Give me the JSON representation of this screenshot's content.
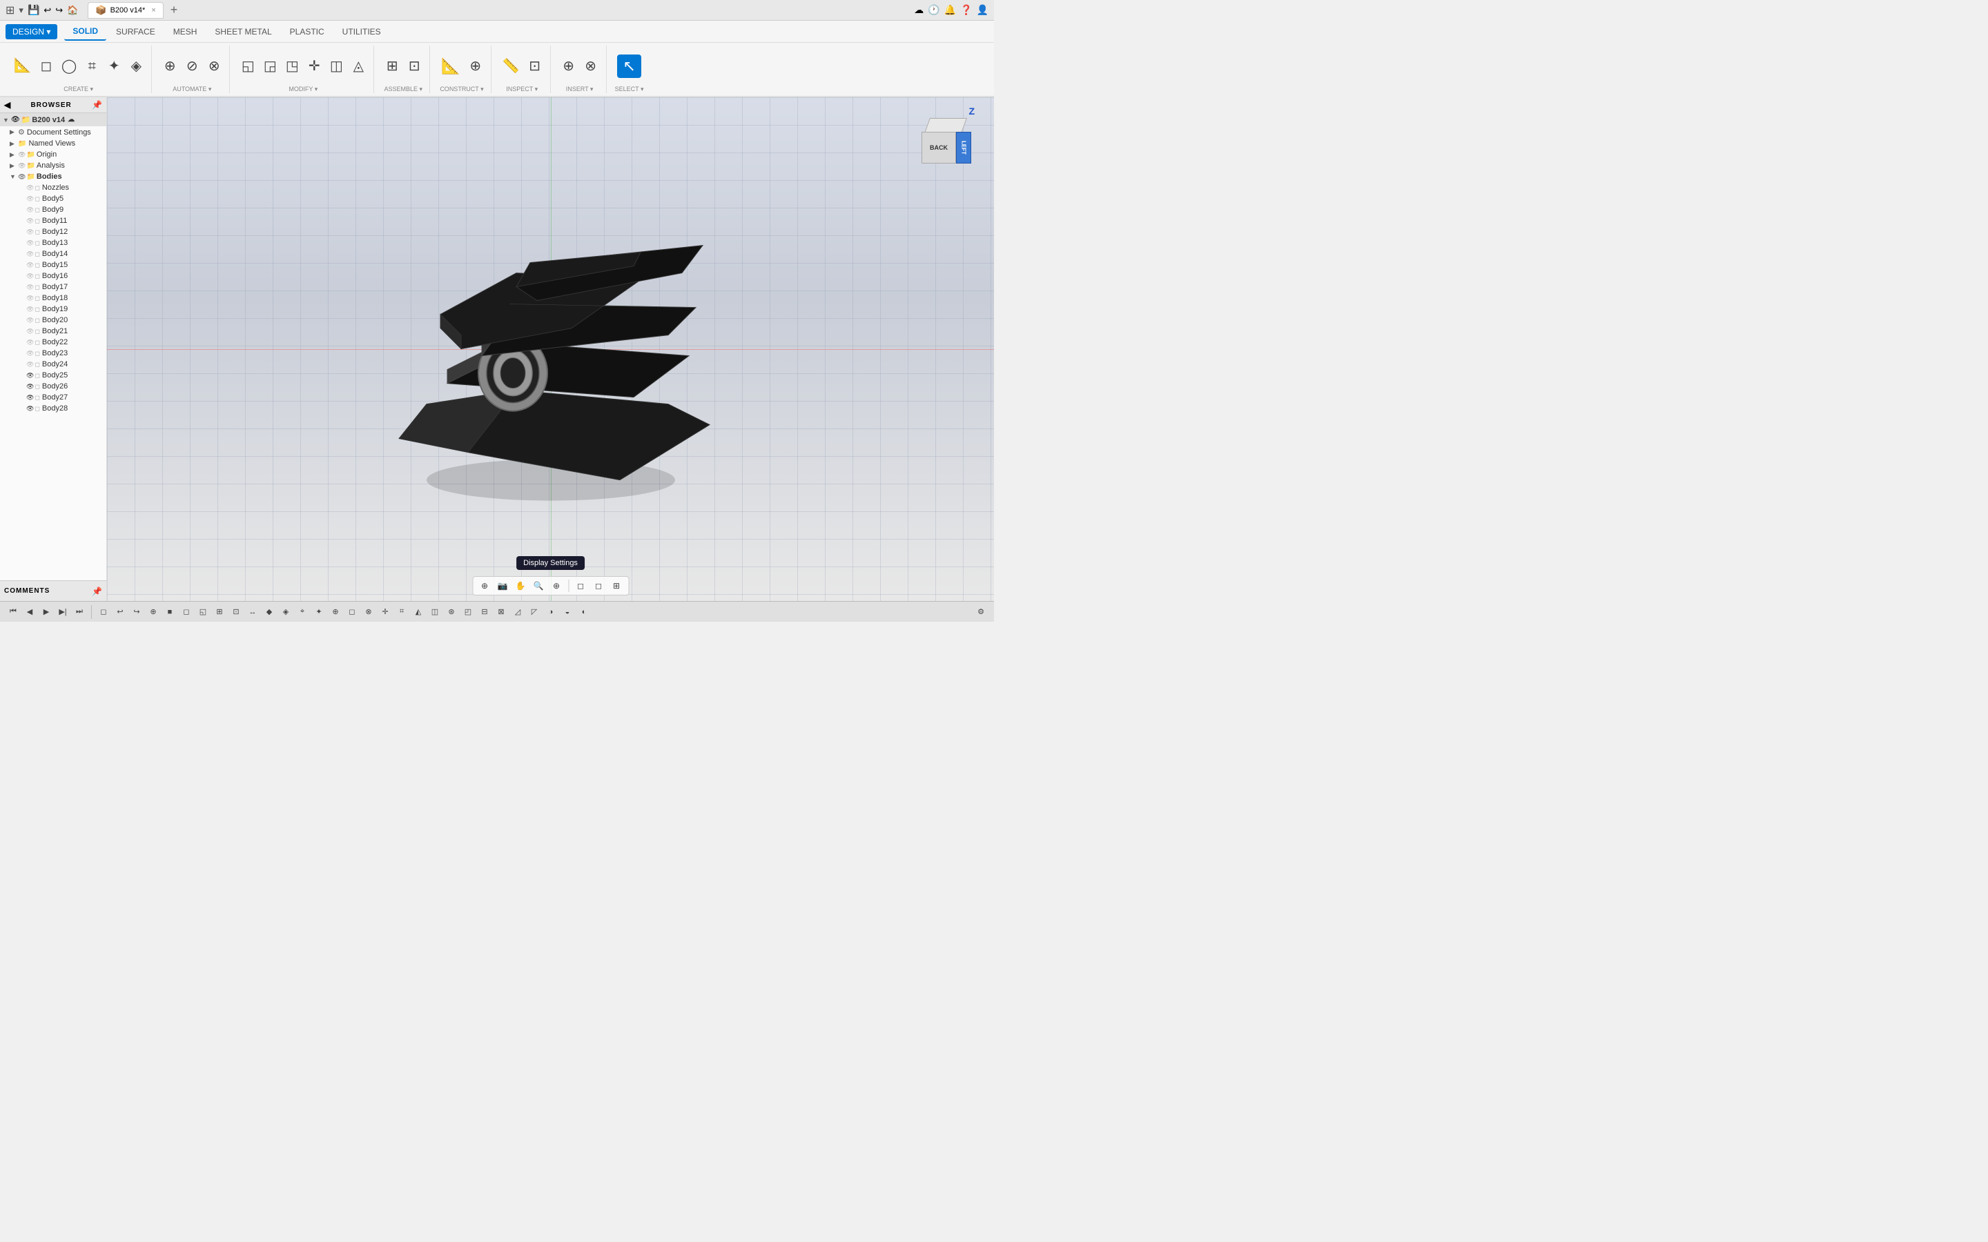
{
  "titlebar": {
    "app_icon": "⊞",
    "doc_title": "B200 v14*",
    "close_label": "×",
    "new_tab_label": "+",
    "settings_icon": "⚙",
    "notification_icon": "🔔",
    "help_icon": "?",
    "user_icon": "👤"
  },
  "tabs": {
    "items": [
      {
        "label": "SOLID",
        "active": true
      },
      {
        "label": "SURFACE",
        "active": false
      },
      {
        "label": "MESH",
        "active": false
      },
      {
        "label": "SHEET METAL",
        "active": false
      },
      {
        "label": "PLASTIC",
        "active": false
      },
      {
        "label": "UTILITIES",
        "active": false
      }
    ]
  },
  "design_button": {
    "label": "DESIGN ▾"
  },
  "ribbon": {
    "groups": [
      {
        "label": "CREATE",
        "icons": [
          "⊞",
          "◻",
          "◯",
          "⌗",
          "✦",
          "◈"
        ]
      },
      {
        "label": "AUTOMATE",
        "icons": [
          "⊕",
          "⊘",
          "⊗"
        ]
      },
      {
        "label": "MODIFY",
        "icons": [
          "◱",
          "◲",
          "◳",
          "✛",
          "◫",
          "◬"
        ]
      },
      {
        "label": "ASSEMBLE",
        "icons": [
          "⊞",
          "⊡"
        ]
      },
      {
        "label": "CONSTRUCT",
        "icons": [
          "◈",
          "⊕"
        ]
      },
      {
        "label": "INSPECT",
        "icons": [
          "⊞",
          "⊡"
        ]
      },
      {
        "label": "INSERT",
        "icons": [
          "⊕",
          "⊗"
        ]
      },
      {
        "label": "SELECT",
        "icons": [
          "↖"
        ],
        "active": true
      }
    ]
  },
  "browser": {
    "title": "BROWSER",
    "items": [
      {
        "indent": 0,
        "expand": "▼",
        "icon": "●",
        "label": "B200 v14",
        "bold": true
      },
      {
        "indent": 1,
        "expand": "▶",
        "icon": "⚙",
        "label": "Document Settings"
      },
      {
        "indent": 1,
        "expand": "▶",
        "icon": "📁",
        "label": "Named Views"
      },
      {
        "indent": 1,
        "expand": "▶",
        "icon": "📁",
        "label": "Origin"
      },
      {
        "indent": 1,
        "expand": "▶",
        "icon": "📁",
        "label": "Analysis"
      },
      {
        "indent": 1,
        "expand": "▼",
        "icon": "📁",
        "label": "Bodies"
      },
      {
        "indent": 2,
        "expand": "",
        "eye": true,
        "box": true,
        "label": "Nozzles"
      },
      {
        "indent": 2,
        "expand": "",
        "eye": true,
        "box": true,
        "label": "Body5"
      },
      {
        "indent": 2,
        "expand": "",
        "eye": true,
        "box": true,
        "label": "Body9"
      },
      {
        "indent": 2,
        "expand": "",
        "eye": true,
        "box": true,
        "label": "Body11"
      },
      {
        "indent": 2,
        "expand": "",
        "eye": true,
        "box": true,
        "label": "Body12"
      },
      {
        "indent": 2,
        "expand": "",
        "eye": true,
        "box": true,
        "label": "Body13"
      },
      {
        "indent": 2,
        "expand": "",
        "eye": true,
        "box": true,
        "label": "Body14"
      },
      {
        "indent": 2,
        "expand": "",
        "eye": true,
        "box": true,
        "label": "Body15"
      },
      {
        "indent": 2,
        "expand": "",
        "eye": true,
        "box": true,
        "label": "Body16"
      },
      {
        "indent": 2,
        "expand": "",
        "eye": true,
        "box": true,
        "label": "Body17"
      },
      {
        "indent": 2,
        "expand": "",
        "eye": true,
        "box": true,
        "label": "Body18"
      },
      {
        "indent": 2,
        "expand": "",
        "eye": true,
        "box": true,
        "label": "Body19"
      },
      {
        "indent": 2,
        "expand": "",
        "eye": true,
        "box": true,
        "label": "Body20"
      },
      {
        "indent": 2,
        "expand": "",
        "eye": true,
        "box": true,
        "label": "Body21"
      },
      {
        "indent": 2,
        "expand": "",
        "eye": true,
        "box": true,
        "label": "Body22"
      },
      {
        "indent": 2,
        "expand": "",
        "eye": true,
        "box": true,
        "label": "Body23"
      },
      {
        "indent": 2,
        "expand": "",
        "eye": true,
        "box": true,
        "label": "Body24"
      },
      {
        "indent": 2,
        "expand": "",
        "eye": true,
        "box": true,
        "label": "Body25"
      },
      {
        "indent": 2,
        "expand": "",
        "eye": true,
        "box": true,
        "label": "Body26"
      },
      {
        "indent": 2,
        "expand": "",
        "eye": true,
        "box": true,
        "label": "Body27"
      },
      {
        "indent": 2,
        "expand": "",
        "eye": true,
        "box": true,
        "label": "Body28"
      }
    ]
  },
  "comments": {
    "title": "COMMENTS"
  },
  "nav_cube": {
    "back_label": "BACK",
    "left_label": "LEFT",
    "z_label": "Z"
  },
  "viewport": {
    "tooltip": "Display Settings"
  },
  "bottom_toolbar": {
    "buttons": [
      "⏮",
      "◀",
      "▶",
      "▶|",
      "⏭"
    ]
  },
  "status_bar": {
    "center_icons": [
      "⊕",
      "◻",
      "✋",
      "🔍",
      "⊕",
      "◻",
      "☰",
      "◻",
      "⊞"
    ]
  }
}
